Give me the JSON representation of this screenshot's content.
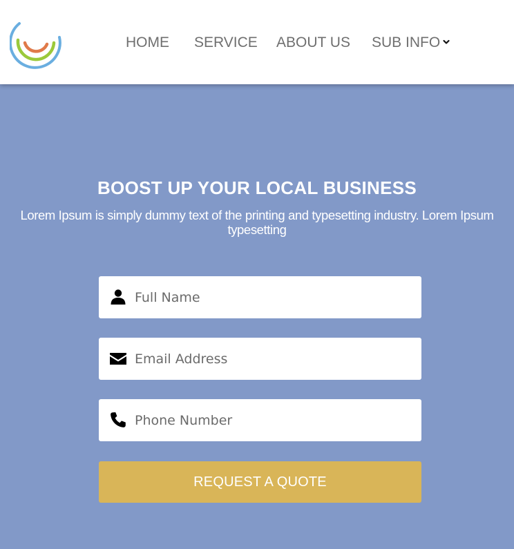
{
  "colors": {
    "background": "#8299c8",
    "header": "#ffffff",
    "nav_text": "#6f6f6f",
    "button": "#d9b558",
    "logo_outer": "#6aaee0",
    "logo_middle": "#9bc93b",
    "logo_inner": "#e07a4a"
  },
  "header": {
    "logo_icon": "logo-rings-icon",
    "nav": {
      "home": "HOME",
      "service": "SERVICE",
      "about": "ABOUT US",
      "sub_info": "SUB INFO"
    },
    "sub_info_icon": "chevron-down-icon"
  },
  "hero": {
    "title": "BOOST UP YOUR LOCAL BUSINESS",
    "text": "Lorem Ipsum is simply dummy text of the printing and typesetting industry. Lorem Ipsum typesetting"
  },
  "form": {
    "full_name": {
      "placeholder": "Full Name",
      "icon": "user-icon"
    },
    "email": {
      "placeholder": "Email Address",
      "icon": "envelope-icon"
    },
    "phone": {
      "placeholder": "Phone Number",
      "icon": "phone-icon"
    },
    "submit_label": "REQUEST A QUOTE"
  }
}
